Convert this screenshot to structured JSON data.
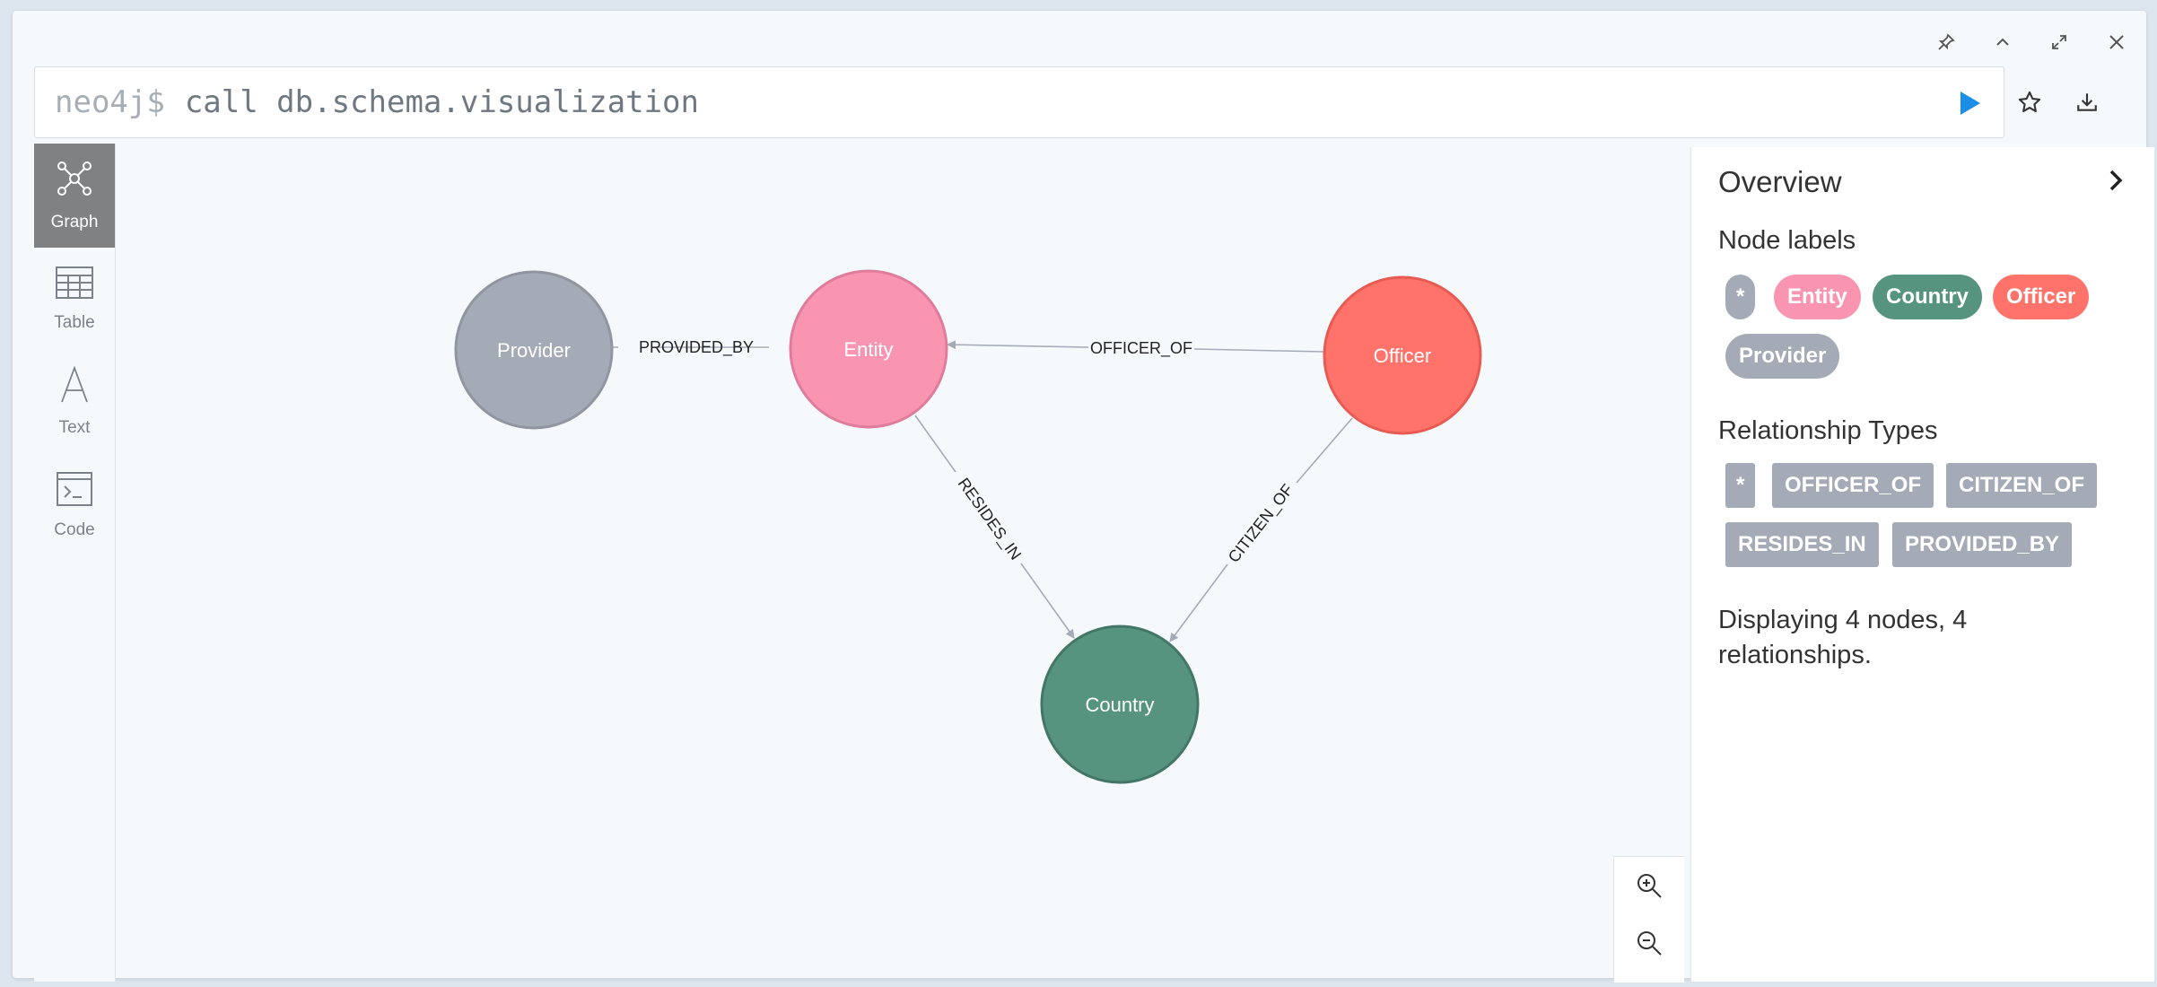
{
  "editor": {
    "prompt": "neo4j$",
    "query": "call db.schema.visualization"
  },
  "window_controls": [
    "pin-icon",
    "collapse-icon",
    "expand-icon",
    "close-icon"
  ],
  "editor_actions": [
    "run-icon",
    "favorite-star-icon",
    "download-icon"
  ],
  "left_nav": [
    {
      "label": "Graph",
      "icon": "graph-icon",
      "active": true
    },
    {
      "label": "Table",
      "icon": "table-icon",
      "active": false
    },
    {
      "label": "Text",
      "icon": "text-icon",
      "active": false
    },
    {
      "label": "Code",
      "icon": "code-icon",
      "active": false
    }
  ],
  "graph": {
    "nodes": [
      {
        "label": "Provider",
        "color": "#a5abb6",
        "border": "#9195a0"
      },
      {
        "label": "Entity",
        "color": "#f994b1",
        "border": "#e07c9b"
      },
      {
        "label": "Officer",
        "color": "#ff736a",
        "border": "#e85a52"
      },
      {
        "label": "Country",
        "color": "#569480",
        "border": "#447666"
      }
    ],
    "relationships": [
      {
        "type": "PROVIDED_BY",
        "from": "Entity",
        "to": "Provider"
      },
      {
        "type": "OFFICER_OF",
        "from": "Officer",
        "to": "Entity"
      },
      {
        "type": "RESIDES_IN",
        "from": "Entity",
        "to": "Country"
      },
      {
        "type": "CITIZEN_OF",
        "from": "Officer",
        "to": "Country"
      }
    ],
    "edge_color": "#a5abb6"
  },
  "zoom": [
    "zoom-in-icon",
    "zoom-out-icon"
  ],
  "overview": {
    "title": "Overview",
    "node_labels_heading": "Node labels",
    "node_labels": [
      {
        "label": "*",
        "color": "#a5abb6"
      },
      {
        "label": "Entity",
        "color": "#f994b1"
      },
      {
        "label": "Country",
        "color": "#569480"
      },
      {
        "label": "Officer",
        "color": "#ff736a"
      },
      {
        "label": "Provider",
        "color": "#a5abb6"
      }
    ],
    "rel_types_heading": "Relationship Types",
    "rel_types": [
      "*",
      "OFFICER_OF",
      "CITIZEN_OF",
      "RESIDES_IN",
      "PROVIDED_BY"
    ],
    "summary": "Displaying 4 nodes, 4 relationships."
  }
}
